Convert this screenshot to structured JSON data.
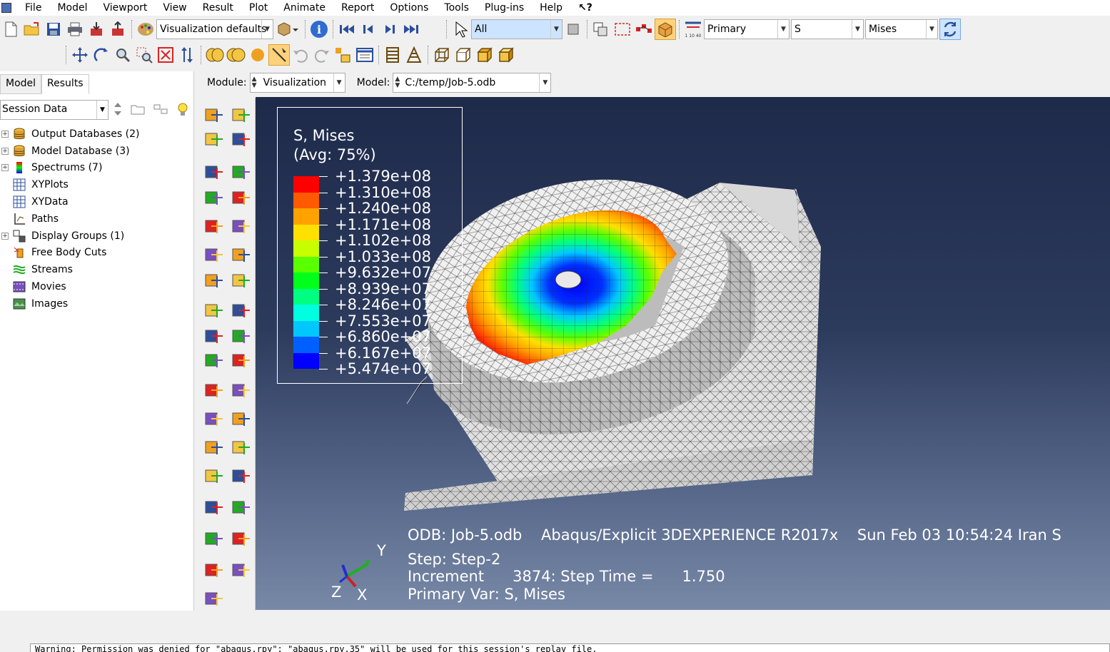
{
  "menu": {
    "items": [
      {
        "label": "File"
      },
      {
        "label": "Model"
      },
      {
        "label": "Viewport"
      },
      {
        "label": "View"
      },
      {
        "label": "Result"
      },
      {
        "label": "Plot"
      },
      {
        "label": "Animate"
      },
      {
        "label": "Report"
      },
      {
        "label": "Options"
      },
      {
        "label": "Tools"
      },
      {
        "label": "Plug-ins"
      },
      {
        "label": "Help"
      }
    ],
    "whats_this": "↖?"
  },
  "toolbar": {
    "visualization_defaults": "Visualization defaults",
    "selection_filter": "All",
    "primary": "Primary",
    "field": "S",
    "invariant": "Mises"
  },
  "left_panel": {
    "tabs": [
      {
        "label": "Model"
      },
      {
        "label": "Results"
      }
    ],
    "active_tab": "Results",
    "session_combo": "Session Data",
    "tree": [
      {
        "label": "Output Databases (2)",
        "expandable": true,
        "icon": "database-icon"
      },
      {
        "label": "Model Database (3)",
        "expandable": true,
        "icon": "database-icon"
      },
      {
        "label": "Spectrums (7)",
        "expandable": true,
        "icon": "spectrum-icon"
      },
      {
        "label": "XYPlots",
        "expandable": false,
        "icon": "xyplot-icon"
      },
      {
        "label": "XYData",
        "expandable": false,
        "icon": "xydata-icon"
      },
      {
        "label": "Paths",
        "expandable": false,
        "icon": "path-icon"
      },
      {
        "label": "Display Groups (1)",
        "expandable": true,
        "icon": "display-group-icon"
      },
      {
        "label": "Free Body Cuts",
        "expandable": false,
        "icon": "free-body-icon"
      },
      {
        "label": "Streams",
        "expandable": false,
        "icon": "stream-icon"
      },
      {
        "label": "Movies",
        "expandable": false,
        "icon": "movie-icon"
      },
      {
        "label": "Images",
        "expandable": false,
        "icon": "image-icon"
      }
    ]
  },
  "module_bar": {
    "module_label": "Module:",
    "module_value": "Visualization",
    "model_label": "Model:",
    "model_value": "C:/temp/Job-5.odb"
  },
  "legend": {
    "title": "S, Mises\n(Avg: 75%)",
    "entries": [
      {
        "value": "+1.379e+08",
        "color": "#ff0000"
      },
      {
        "value": "+1.310e+08",
        "color": "#ff5a00"
      },
      {
        "value": "+1.240e+08",
        "color": "#ffa200"
      },
      {
        "value": "+1.171e+08",
        "color": "#ffe000"
      },
      {
        "value": "+1.102e+08",
        "color": "#c8ff00"
      },
      {
        "value": "+1.033e+08",
        "color": "#5aff00"
      },
      {
        "value": "+9.632e+07",
        "color": "#00ff1a"
      },
      {
        "value": "+8.939e+07",
        "color": "#00ff80"
      },
      {
        "value": "+8.246e+07",
        "color": "#00ffe0"
      },
      {
        "value": "+7.553e+07",
        "color": "#00c8ff"
      },
      {
        "value": "+6.860e+07",
        "color": "#0060ff"
      },
      {
        "value": "+6.167e+07",
        "color": "#0000ff"
      },
      {
        "value": "+5.474e+07",
        "color": "#0000ff"
      }
    ]
  },
  "viewport_info": {
    "odb_line": "ODB: Job-5.odb    Abaqus/Explicit 3DEXPERIENCE R2017x    Sun Feb 03 10:54:24 Iran S",
    "step_line": "Step: Step-2",
    "increment_line": "Increment      3874: Step Time =      1.750",
    "primary_var_line": "Primary Var: S, Mises"
  },
  "triad": {
    "y": "Y",
    "z": "Z",
    "x": "X"
  },
  "message": "Warning: Permission was denied for \"abaqus.rpy\"; \"abaqus.rpy.35\" will be used for this session's replay file."
}
